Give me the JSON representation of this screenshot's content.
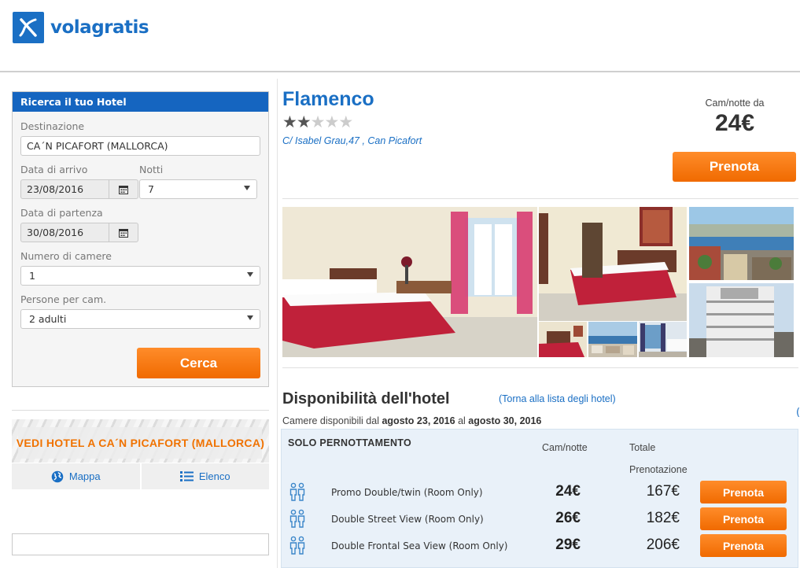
{
  "brand": {
    "name": "volagratis",
    "logo_icon": "plane-x-logo-icon"
  },
  "search": {
    "title": "Ricerca il tuo Hotel",
    "destination_label": "Destinazione",
    "destination_value": "CA´N PICAFORT (MALLORCA)",
    "arrival_label": "Data di arrivo",
    "arrival_value": "23/08/2016",
    "nights_label": "Notti",
    "nights_value": "7",
    "departure_label": "Data di partenza",
    "departure_value": "30/08/2016",
    "rooms_label": "Numero di camere",
    "rooms_value": "1",
    "persons_label": "Persone per cam.",
    "persons_value": "2 adulti",
    "search_button": "Cerca"
  },
  "city_banner": {
    "text": "VEDI HOTEL A CA´N PICAFORT (MALLORCA)"
  },
  "view_switch": {
    "map_label": "Mappa",
    "list_label": "Elenco"
  },
  "hotel": {
    "name": "Flamenco",
    "stars": 2,
    "max_stars": 5,
    "address": "C/ Isabel Grau,47 , Can Picafort",
    "price_label": "Cam/notte da",
    "price": "24€",
    "book_button": "Prenota"
  },
  "availability": {
    "title": "Disponibilità dell'hotel",
    "back_link": "(Torna alla lista degli hotel)",
    "dates_prefix": "Camere disponibili dal",
    "date_from": "agosto 23, 2016",
    "dates_mid": "al",
    "date_to": "agosto 30, 2016",
    "board_type": "SOLO PERNOTTAMENTO",
    "col_price": "Cam/notte",
    "col_total_1": "Totale",
    "col_total_2": "Prenotazione",
    "rooms": [
      {
        "name": "Promo Double/twin (Room Only)",
        "price": "24€",
        "total": "167€",
        "button": "Prenota"
      },
      {
        "name": "Double Street View (Room Only)",
        "price": "26€",
        "total": "182€",
        "button": "Prenota"
      },
      {
        "name": "Double Frontal Sea View (Room Only)",
        "price": "29€",
        "total": "206€",
        "button": "Prenota"
      }
    ]
  },
  "colors": {
    "brand_blue": "#1a6fc4",
    "cta_orange": "#f07200",
    "panel_blue": "#1565c0"
  },
  "edge_fragment": "("
}
